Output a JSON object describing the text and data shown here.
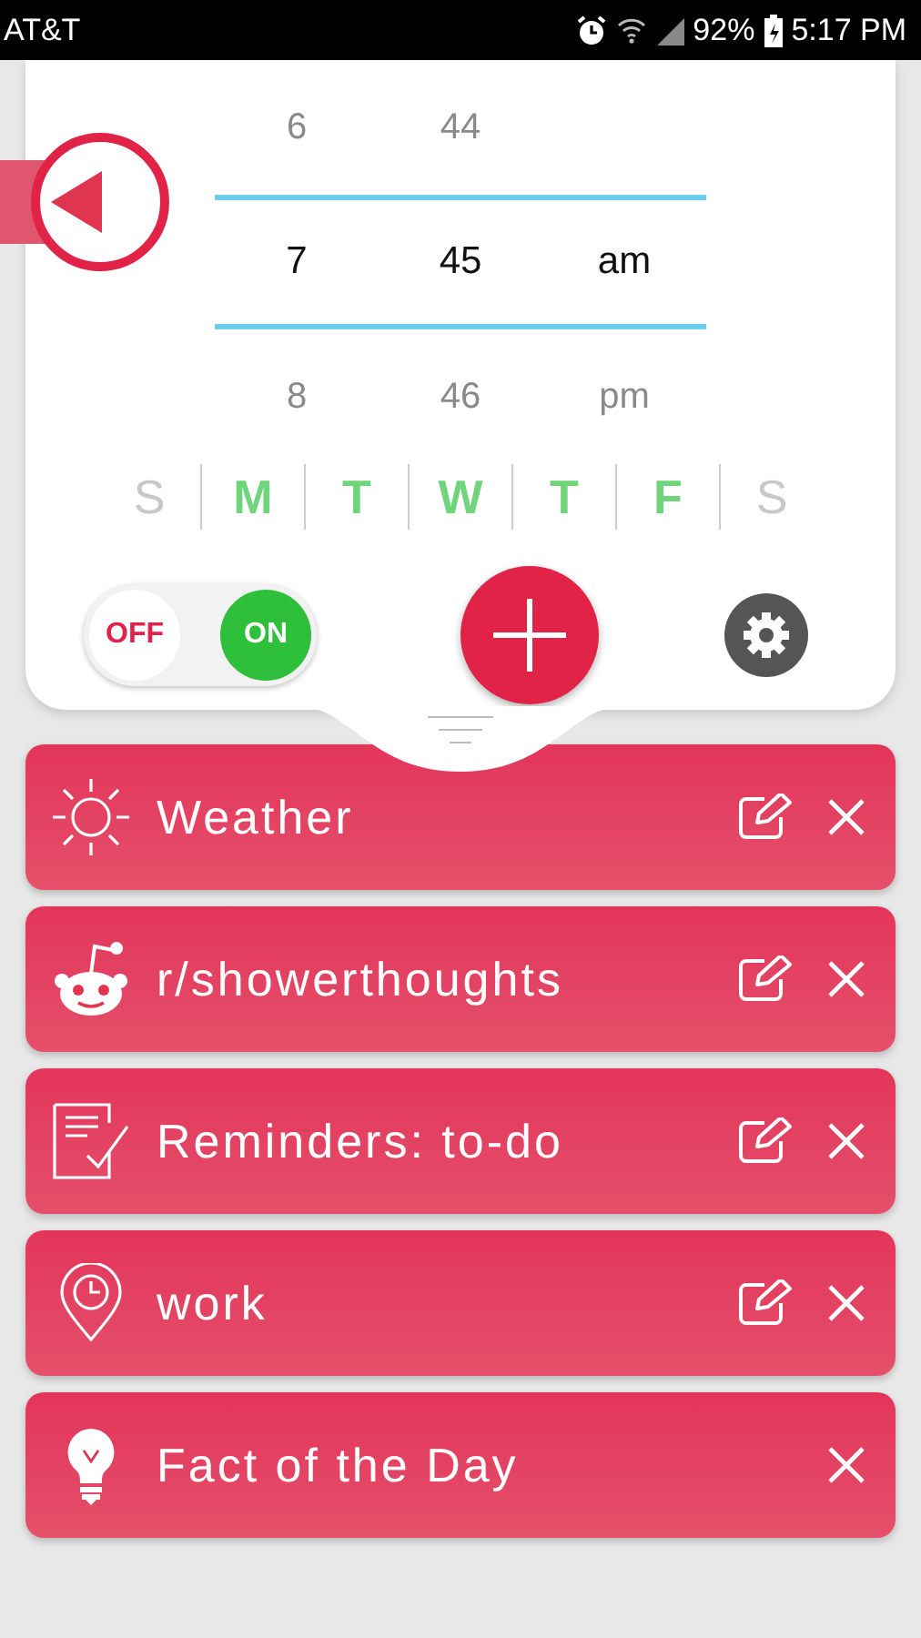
{
  "status_bar": {
    "carrier": "AT&T",
    "battery": "92%",
    "time": "5:17 PM"
  },
  "time_picker": {
    "rows": [
      {
        "hour": "6",
        "minute": "44",
        "selected": false
      },
      {
        "hour": "7",
        "minute": "45",
        "period": "am",
        "selected": true
      },
      {
        "hour": "8",
        "minute": "46",
        "period": "pm",
        "selected": false
      }
    ]
  },
  "days": [
    {
      "label": "S",
      "on": false
    },
    {
      "label": "M",
      "on": true
    },
    {
      "label": "T",
      "on": true
    },
    {
      "label": "W",
      "on": true
    },
    {
      "label": "T",
      "on": true
    },
    {
      "label": "F",
      "on": true
    },
    {
      "label": "S",
      "on": false
    }
  ],
  "toggle": {
    "off_label": "OFF",
    "on_label": "ON",
    "on": true
  },
  "items": [
    {
      "title": "Weather",
      "kind": "weather",
      "editable": true
    },
    {
      "title": "r/showerthoughts",
      "kind": "reddit",
      "editable": true
    },
    {
      "title": "Reminders: to-do",
      "kind": "reminders",
      "editable": true
    },
    {
      "title": "work",
      "kind": "location",
      "editable": true
    },
    {
      "title": "Fact of the Day",
      "kind": "fact",
      "editable": false
    }
  ]
}
